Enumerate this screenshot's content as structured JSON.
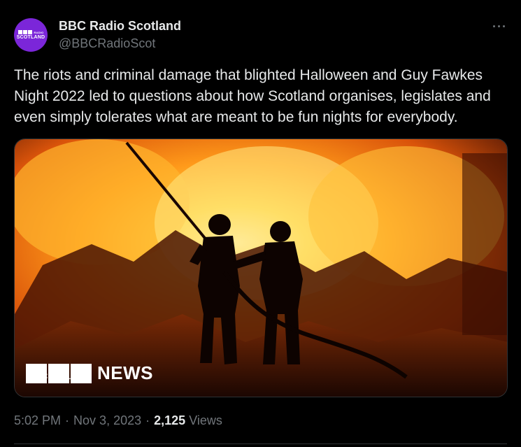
{
  "author": {
    "name": "BBC Radio Scotland",
    "handle": "@BBCRadioScot",
    "avatar": {
      "brand": "BBC",
      "sub": "RADIO",
      "region": "SCOTLAND",
      "color": "#7b26d9"
    }
  },
  "menu_icon": "more-horizontal-icon",
  "tweet": {
    "text": "The riots and criminal damage that blighted Halloween and Guy Fawkes Night 2022 led to questions about how Scotland organises, legislates and even simply tolerates what are meant to be fun nights for everybody."
  },
  "media": {
    "watermark_url": "bbc.co.uk",
    "watermark_brand": "NEWS"
  },
  "meta": {
    "time": "5:02 PM",
    "sep1": "·",
    "date": "Nov 3, 2023",
    "sep2": "·",
    "views_count": "2,125",
    "views_label": "Views"
  }
}
